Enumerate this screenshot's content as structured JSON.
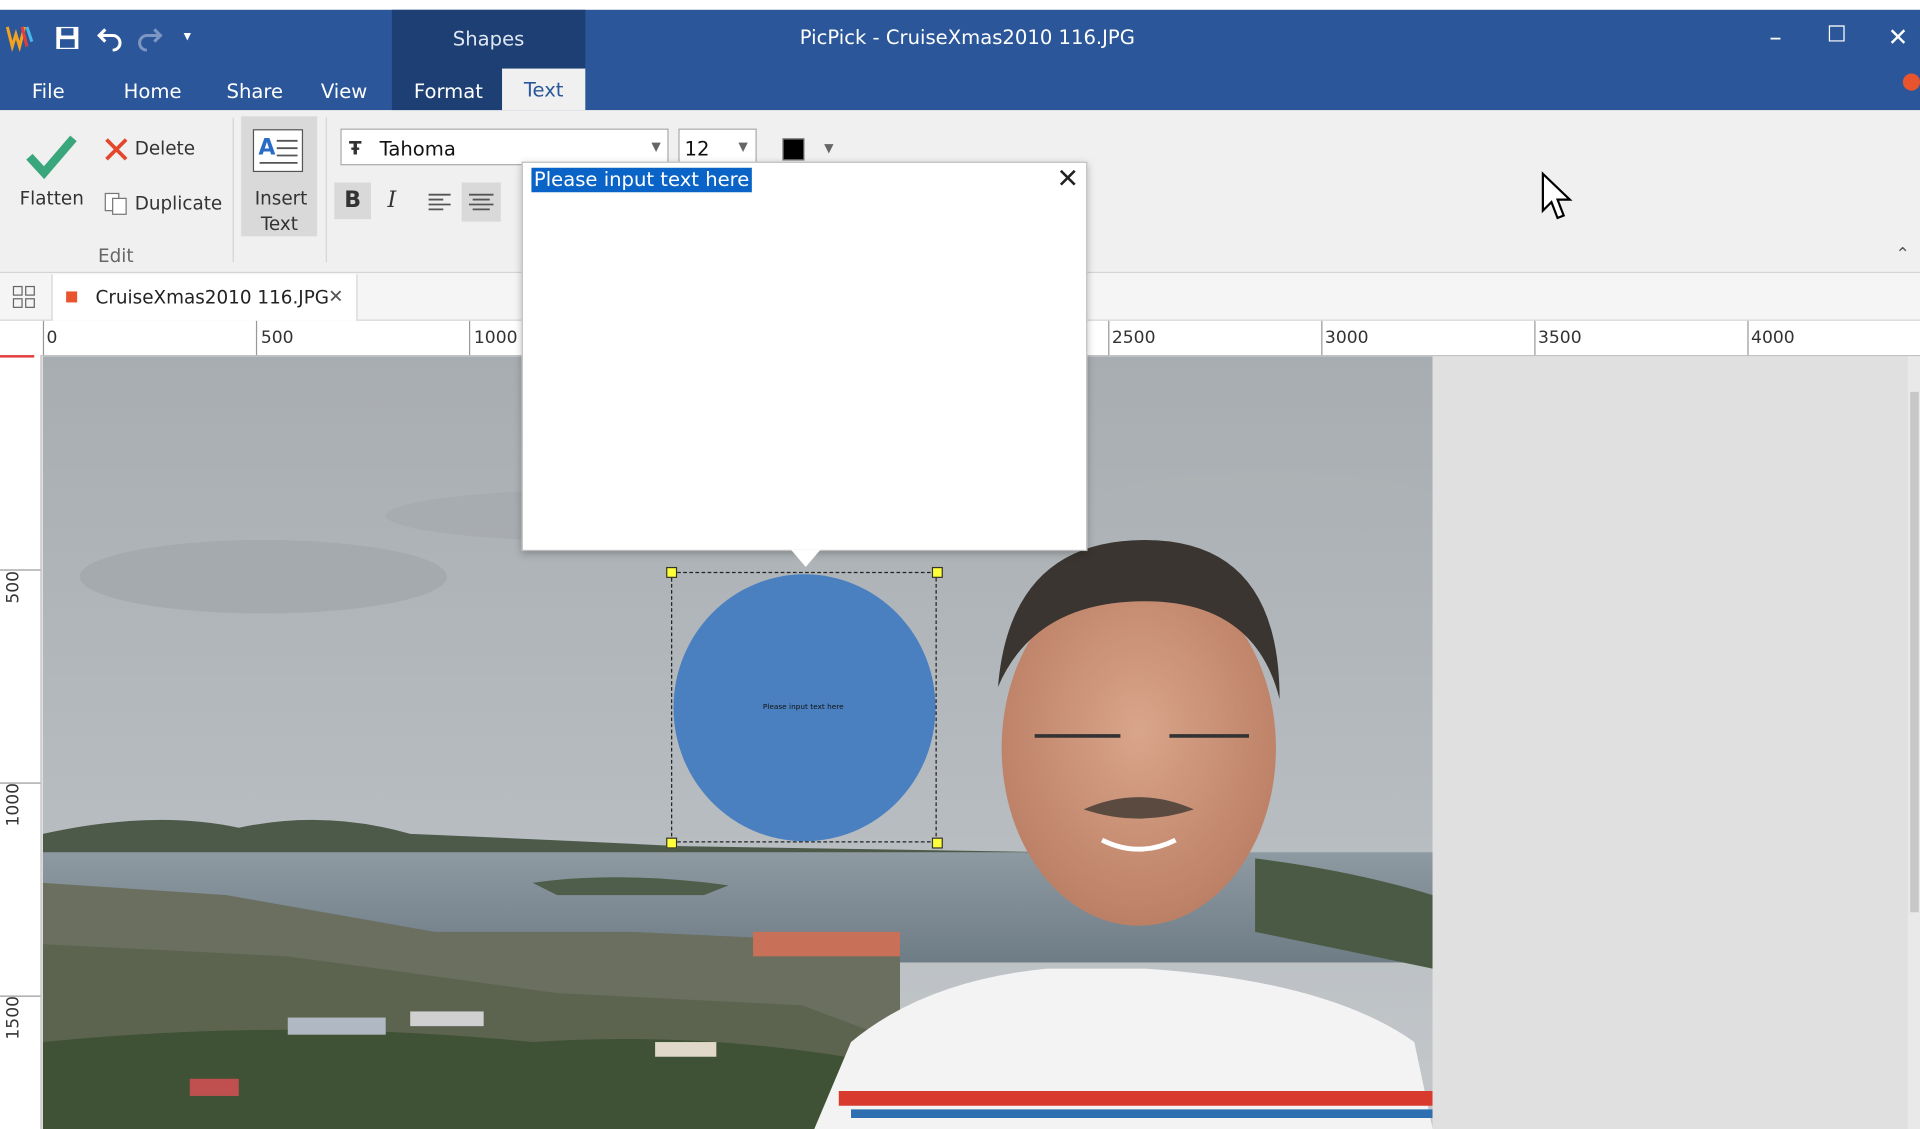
{
  "window": {
    "title": "PicPick - CruiseXmas2010 116.JPG",
    "minimize_icon": "minimize-icon",
    "maximize_icon": "maximize-icon",
    "close_icon": "close-icon"
  },
  "quick_access": {
    "icons": [
      "picpick-logo-icon",
      "save-icon",
      "undo-icon",
      "redo-icon",
      "customize-dropdown-icon"
    ]
  },
  "ribbon_tabs": {
    "context_group": "Shapes",
    "tabs": [
      "File",
      "Home",
      "Share",
      "View",
      "Format",
      "Text"
    ],
    "active": "Text"
  },
  "ribbon": {
    "flatten_label": "Flatten",
    "delete_label": "Delete",
    "duplicate_label": "Duplicate",
    "edit_group_label": "Edit",
    "insert_text_label_1": "Insert",
    "insert_text_label_2": "Text",
    "font_name": "Tahoma",
    "font_size": "12",
    "bold_label": "B",
    "italic_label": "I",
    "text_color": "#000000",
    "collapse_icon": "chevron-up-icon"
  },
  "document_tab": {
    "name": "CruiseXmas2010 116.JPG",
    "close_icon": "close-icon",
    "thumbnails_icon": "grid-icon"
  },
  "rulers": {
    "horizontal_labels": [
      "0",
      "500",
      "1000",
      "2500",
      "3000",
      "3500",
      "4000"
    ],
    "vertical_labels": [
      "500",
      "1000",
      "1500"
    ]
  },
  "text_popup": {
    "text": "Please input text here",
    "close_glyph": "✕"
  },
  "shape": {
    "type": "circle",
    "fill": "#4a80c0",
    "label": "Please input text here"
  },
  "colors": {
    "titlebar": "#2b579a",
    "context_tab": "#1e3f73",
    "selection_highlight": "#0a64c8",
    "handle": "#ffff3a"
  }
}
